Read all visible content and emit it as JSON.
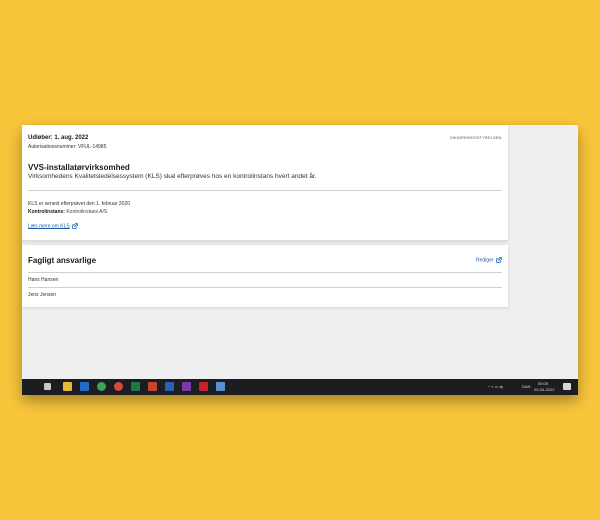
{
  "kls_card": {
    "issued": "Udløber: 1. aug. 2022",
    "authorization": "Autorisationsnummer: VFUL-14985",
    "agency": "SIKKERHEDSSTYRELSEN",
    "company_type": "VVS-installatørvirksomhed",
    "description": "Virksomhedens Kvalitetsledelsessystem (KLS) skal efterprøves hos en kontrolinstans hvert andet år.",
    "last_checked": "KLS er senest efterprøvet den 1. februar 2020",
    "control_label": "Kontrolinstans:",
    "control_value": "Kontrolinstans A/S",
    "read_more": "Læs mere om KLS"
  },
  "responsible_card": {
    "title": "Fagligt ansvarlige",
    "edit_label": "Rediger",
    "people": [
      "Hans Hansen",
      "Jens Jensen"
    ]
  },
  "taskbar": {
    "apps": [
      {
        "name": "task-view-icon",
        "color": "#c9c9c9"
      },
      {
        "name": "file-explorer-icon",
        "color": "#e8b93a"
      },
      {
        "name": "outlook-icon",
        "color": "#1f6fc8"
      },
      {
        "name": "chrome-icon",
        "color": "#3da34f"
      },
      {
        "name": "chrome-alt-icon",
        "color": "#d54a3b"
      },
      {
        "name": "excel-icon",
        "color": "#1e7a45"
      },
      {
        "name": "powerpoint-icon",
        "color": "#c8452c"
      },
      {
        "name": "word-icon",
        "color": "#2b5fb3"
      },
      {
        "name": "onenote-icon",
        "color": "#7a3aa8"
      },
      {
        "name": "acrobat-icon",
        "color": "#c8202a"
      },
      {
        "name": "notes-icon",
        "color": "#5b8fd6"
      }
    ],
    "language": "DAN",
    "time": "05:05",
    "date": "20-04-2022"
  }
}
